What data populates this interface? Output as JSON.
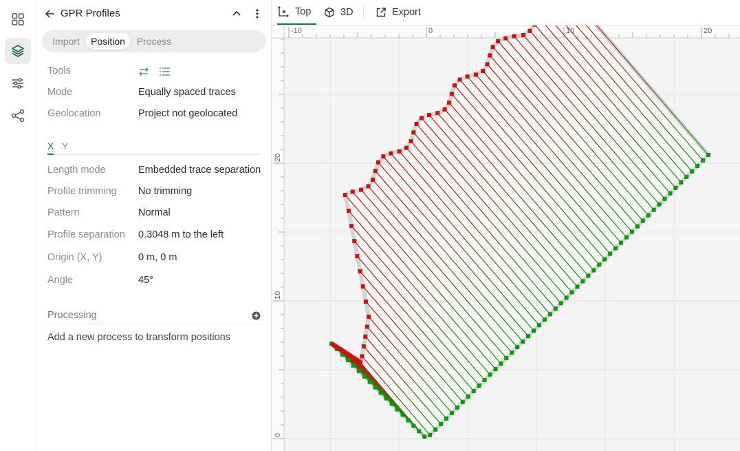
{
  "rail": {
    "items": [
      {
        "name": "dashboard-grid-icon"
      },
      {
        "name": "layers-icon",
        "active": true
      },
      {
        "name": "sliders-icon"
      },
      {
        "name": "share-nodes-icon"
      }
    ]
  },
  "panel": {
    "title": "GPR Profiles",
    "tabs": [
      "Import",
      "Position",
      "Process"
    ],
    "active_tab": "Position",
    "tools_label": "Tools",
    "mode_label": "Mode",
    "mode_value": "Equally spaced traces",
    "geolocation_label": "Geolocation",
    "geolocation_value": "Project not geolocated",
    "axis_tabs": [
      "X",
      "Y"
    ],
    "active_axis": "X",
    "props": [
      {
        "label": "Length mode",
        "value": "Embedded trace separation"
      },
      {
        "label": "Profile trimming",
        "value": "No trimming"
      },
      {
        "label": "Pattern",
        "value": "Normal"
      },
      {
        "label": "Profile separation",
        "value": "0.3048 m to the left"
      },
      {
        "label": "Origin (X, Y)",
        "value": "0 m, 0 m"
      },
      {
        "label": "Angle",
        "value": "45°"
      }
    ],
    "processing_label": "Processing",
    "processing_hint": "Add a new process to transform positions"
  },
  "toolbar": {
    "top_label": "Top",
    "three_d_label": "3D",
    "export_label": "Export",
    "active_view": "Top"
  },
  "view": {
    "x_ticks": [
      "-10",
      "0",
      "10",
      "20"
    ],
    "y_ticks": [
      "20",
      "10",
      "0"
    ],
    "start_color": "#0a9a0a",
    "end_color": "#cc1111"
  }
}
